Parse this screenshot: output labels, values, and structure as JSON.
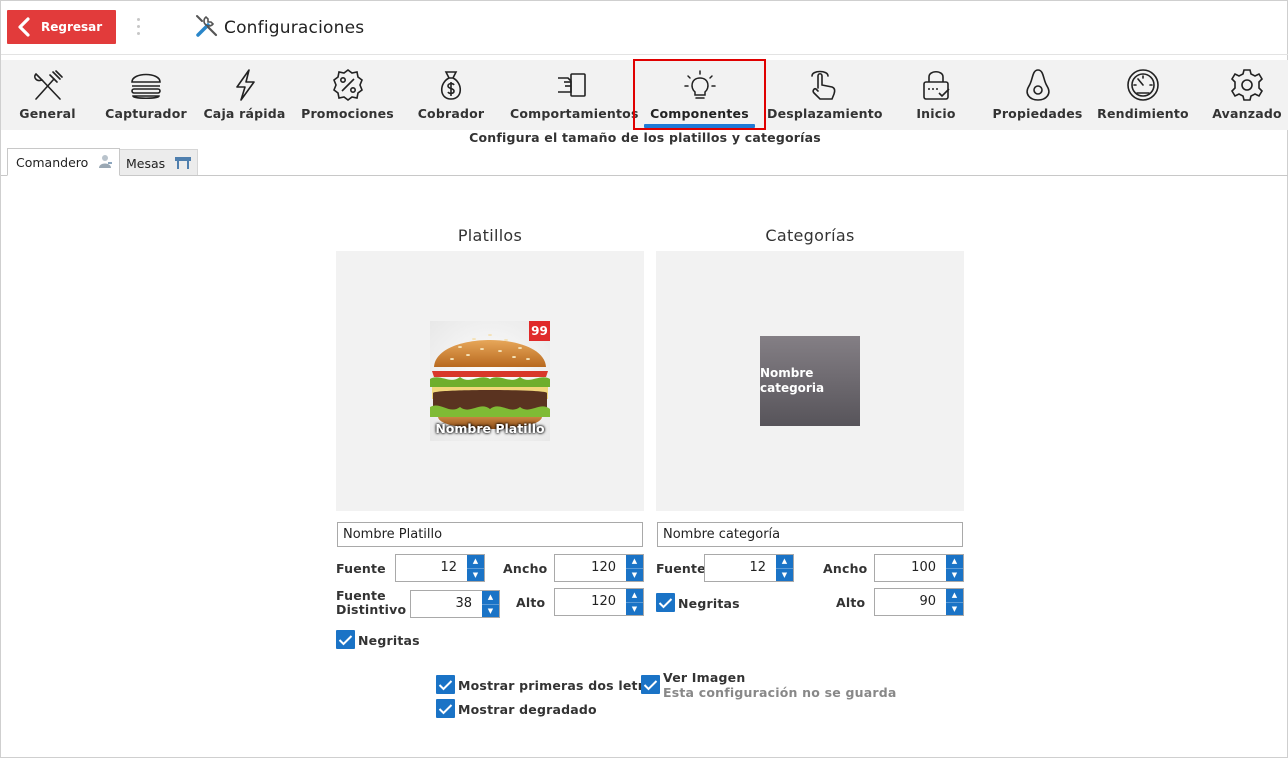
{
  "header": {
    "back_label": "Regresar",
    "title": "Configuraciones",
    "title_icon": "tools-icon"
  },
  "nav": [
    {
      "label": "General",
      "icon": "fork-knife-icon"
    },
    {
      "label": "Capturador",
      "icon": "burger-icon"
    },
    {
      "label": "Caja rápida",
      "icon": "lightning-icon"
    },
    {
      "label": "Promociones",
      "icon": "percent-badge-icon"
    },
    {
      "label": "Cobrador",
      "icon": "money-bag-icon"
    },
    {
      "label": "Comportamientos",
      "icon": "hand-card-icon"
    },
    {
      "label": "Componentes",
      "icon": "lightbulb-icon",
      "active": true
    },
    {
      "label": "Desplazamiento",
      "icon": "swipe-hand-icon"
    },
    {
      "label": "Inicio",
      "icon": "lock-check-icon"
    },
    {
      "label": "Propiedades",
      "icon": "avocado-icon"
    },
    {
      "label": "Rendimiento",
      "icon": "speedometer-icon"
    },
    {
      "label": "Avanzado",
      "icon": "gear-icon"
    }
  ],
  "subtitle": "Configura el tamaño de los platillos y categorías",
  "tabs": [
    {
      "label": "Comandero",
      "icon": "waiter-icon",
      "active": true
    },
    {
      "label": "Mesas",
      "icon": "table-icon"
    }
  ],
  "platillos": {
    "title": "Platillos",
    "badge": "99",
    "card_name": "Nombre Platillo",
    "name_value": "Nombre Platillo",
    "fuente_label": "Fuente",
    "fuente": "12",
    "ancho_label": "Ancho",
    "ancho": "120",
    "fuente_distintivo_label": "Fuente\nDistintivo",
    "fuente_distintivo": "38",
    "alto_label": "Alto",
    "alto": "120",
    "negritas_label": "Negritas",
    "negritas": true
  },
  "categorias": {
    "title": "Categorías",
    "card_name": "Nombre\ncategoria",
    "name_value": "Nombre categoría",
    "fuente_label": "Fuente",
    "fuente": "12",
    "ancho_label": "Ancho",
    "ancho": "100",
    "negritas_label": "Negritas",
    "negritas": true,
    "alto_label": "Alto",
    "alto": "90"
  },
  "options": {
    "mostrar_letras": "Mostrar primeras dos letras",
    "mostrar_degradado": "Mostrar degradado",
    "ver_imagen": "Ver Imagen",
    "ver_imagen_note": "Esta configuración no se guarda"
  },
  "colors": {
    "back_button": "#e23b3b",
    "accent": "#1a73c6",
    "highlight_box": "#e00000",
    "badge": "#e02a2a"
  }
}
